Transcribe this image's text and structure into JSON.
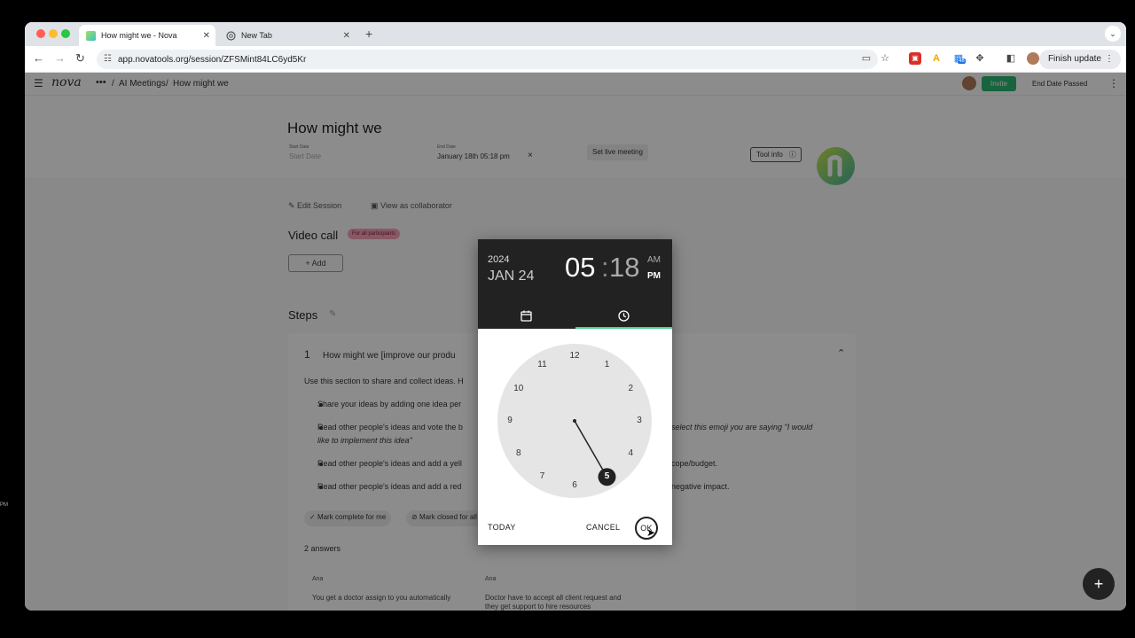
{
  "browser": {
    "tabs": [
      {
        "title": "How might we - Nova",
        "active": true
      },
      {
        "title": "New Tab",
        "active": false
      }
    ],
    "new_tab": "+",
    "tab_menu": "⌄",
    "url": "app.novatools.org/session/ZFSMint84LC6yd5Kr",
    "extension_badge": "48",
    "finish_update": "Finish update",
    "colors": {
      "tab_strip": "#dfe3e7",
      "omnibox": "#eef1f4"
    }
  },
  "app": {
    "logo": "nova",
    "breadcrumb": {
      "root": "AI Meetings",
      "current": "How might we",
      "separator": "/"
    },
    "invite_label": "Invite",
    "end_date_status": "End Date Passed",
    "colors": {
      "invite": "#2bb673",
      "overlay": "rgba(0,0,0,0.45)"
    }
  },
  "session": {
    "title": "How might we",
    "start_date_label": "Start Date",
    "start_date_placeholder": "Start Date",
    "end_date_label": "End Date",
    "end_date_value": "January 18th 05:18 pm",
    "clear_end": "×",
    "set_live_meeting": "Set live meeting",
    "tool_info": "Tool info",
    "edit_session": "Edit Session",
    "view_as_collaborator": "View as collaborator",
    "video_call_title": "Video call",
    "participants_badge": "For all participants",
    "add_label": "Add",
    "steps_title": "Steps",
    "step": {
      "number": "1",
      "title": "How might we [improve our produ",
      "intro": "Use this section to share and collect ideas. H",
      "bullets": [
        {
          "left": "Share your ideas by adding one idea per",
          "right": ""
        },
        {
          "left": "Read other people's ideas and vote the b",
          "right": "select this emoji you are saying \"I would",
          "cont": "like to implement this idea\""
        },
        {
          "left": "Read other people's ideas and add a yell",
          "right": "cope/budget."
        },
        {
          "left": "Read other people's ideas and add a red",
          "right": "negative impact."
        }
      ],
      "mark_complete": "Mark complete for me",
      "mark_closed": "Mark closed for all",
      "answers_count": "2 answers",
      "answers": [
        {
          "author": "Ana",
          "text": "You get a doctor assign to you automatically"
        },
        {
          "author": "Ana",
          "text": "Doctor have to accept all client request and they get support to hire resources"
        }
      ]
    },
    "fab": "+",
    "side_label": "PM"
  },
  "picker": {
    "year": "2024",
    "date": "JAN 24",
    "hour": "05",
    "separator": ":",
    "minute": "18",
    "am": "AM",
    "pm": "PM",
    "selected_hour": 5,
    "clock_numbers": [
      "12",
      "1",
      "2",
      "3",
      "4",
      "5",
      "6",
      "7",
      "8",
      "9",
      "10",
      "11"
    ],
    "today_label": "TODAY",
    "cancel_label": "CANCEL",
    "ok_label": "OK",
    "colors": {
      "header": "#222222",
      "tab_indicator": "#43d48c",
      "face": "#e5e5e5"
    }
  }
}
